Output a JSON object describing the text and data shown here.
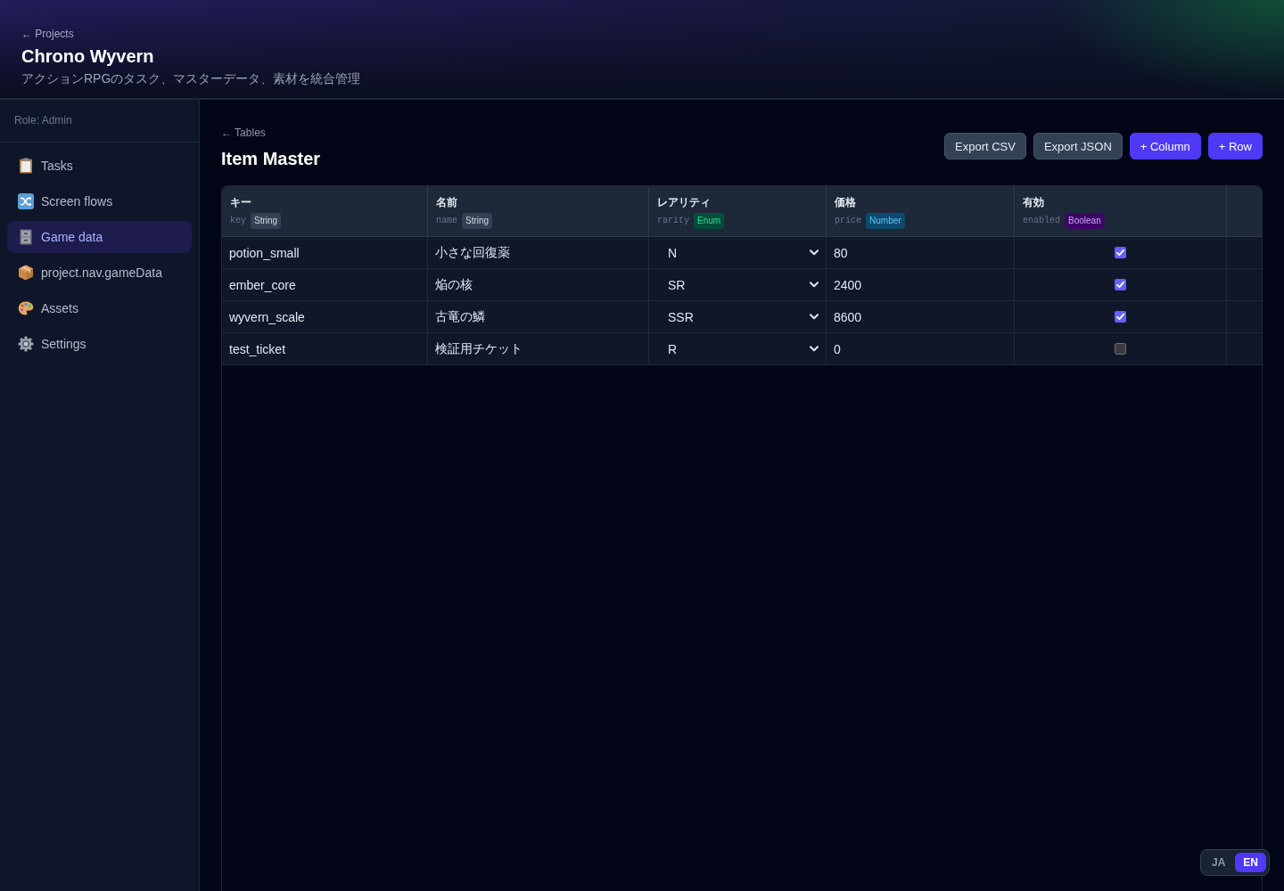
{
  "header": {
    "breadcrumb": "← Projects",
    "title": "Chrono Wyvern",
    "subtitle": "アクションRPGのタスク、マスターデータ、素材を統合管理"
  },
  "sidebar": {
    "role": "Role: Admin",
    "items": [
      {
        "label": "Tasks",
        "selected": false
      },
      {
        "label": "Screen flows",
        "selected": false
      },
      {
        "label": "Game data",
        "selected": true
      },
      {
        "label": "project.nav.gameData",
        "selected": false
      },
      {
        "label": "Assets",
        "selected": false
      },
      {
        "label": "Settings",
        "selected": false
      }
    ]
  },
  "page": {
    "breadcrumb": "← Tables",
    "title": "Item Master",
    "buttons": [
      {
        "label": "Export CSV",
        "kind": "secondary"
      },
      {
        "label": "Export JSON",
        "kind": "secondary"
      },
      {
        "label": "+ Column",
        "kind": "primary"
      },
      {
        "label": "+ Row",
        "kind": "primary"
      }
    ]
  },
  "table": {
    "columns": [
      {
        "label": "キー",
        "key": "key",
        "type": "String",
        "kind": "string"
      },
      {
        "label": "名前",
        "key": "name",
        "type": "String",
        "kind": "string"
      },
      {
        "label": "レアリティ",
        "key": "rarity",
        "type": "Enum",
        "kind": "enum"
      },
      {
        "label": "価格",
        "key": "price",
        "type": "Number",
        "kind": "number"
      },
      {
        "label": "有効",
        "key": "enabled",
        "type": "Boolean",
        "kind": "boolean"
      }
    ],
    "rows": [
      {
        "cells": [
          {
            "text": "potion_small"
          },
          {
            "text": "小さな回復薬"
          },
          {
            "text": "N"
          },
          {
            "text": "80"
          },
          {
            "checked": true
          }
        ]
      },
      {
        "cells": [
          {
            "text": "ember_core"
          },
          {
            "text": "焔の核"
          },
          {
            "text": "SR"
          },
          {
            "text": "2400"
          },
          {
            "checked": true
          }
        ]
      },
      {
        "cells": [
          {
            "text": "wyvern_scale"
          },
          {
            "text": "古竜の鱗"
          },
          {
            "text": "SSR"
          },
          {
            "text": "8600"
          },
          {
            "checked": true
          }
        ]
      },
      {
        "cells": [
          {
            "text": "test_ticket"
          },
          {
            "text": "検証用チケット"
          },
          {
            "text": "R"
          },
          {
            "text": "0"
          },
          {
            "checked": false
          }
        ]
      }
    ]
  },
  "language_switch": [
    {
      "label": "JA",
      "selected": false
    },
    {
      "label": "EN",
      "selected": true
    }
  ]
}
